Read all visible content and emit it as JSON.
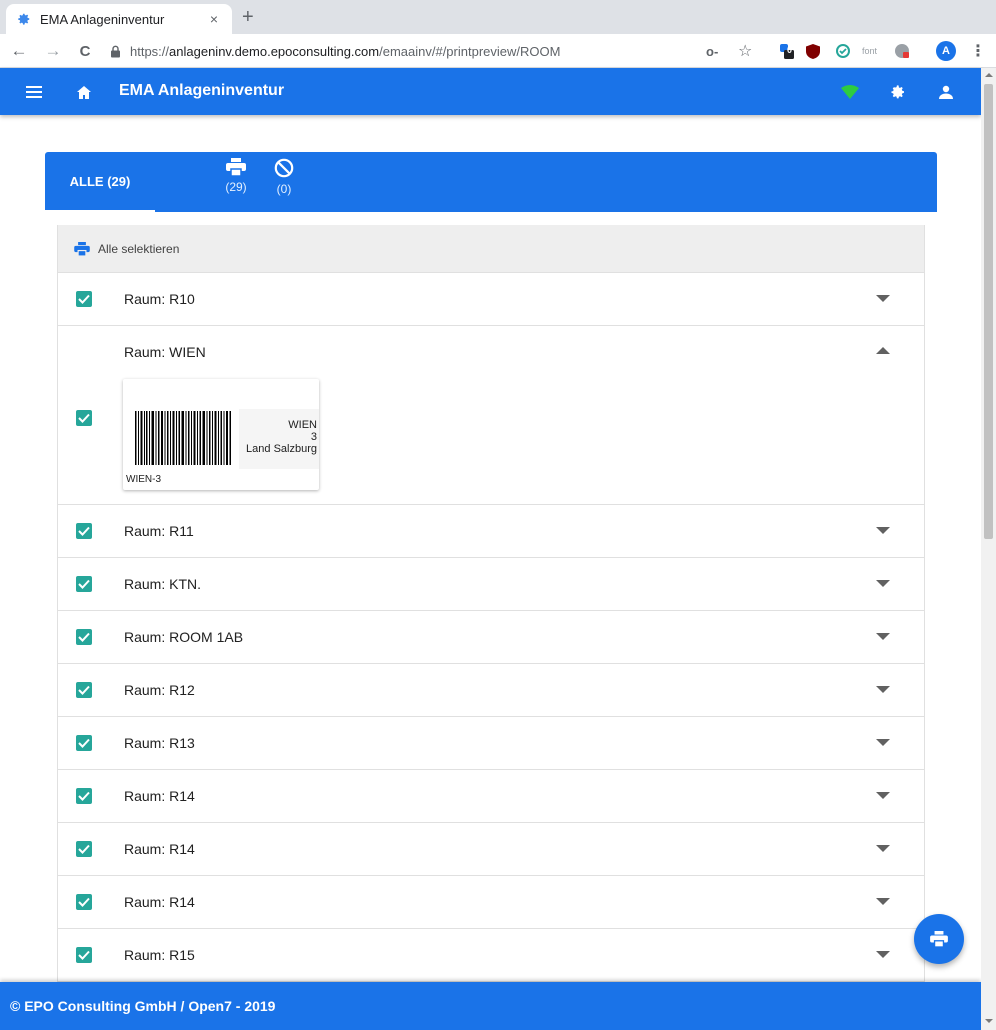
{
  "browser": {
    "tab_title": "EMA Anlageninventur",
    "tab_close": "×",
    "new_tab": "+",
    "back": "←",
    "forward": "→",
    "reload": "C",
    "url_scheme": "https://",
    "url_host": "anlageninv.demo.epoconsulting.com",
    "url_path": "/emaainv/#/printpreview/ROOM",
    "key": "o-",
    "star": "☆",
    "ext_badge": "0",
    "ext_font": "font",
    "profile_initial": "A",
    "menu": "⋮"
  },
  "appbar": {
    "title": "EMA Anlageninventur",
    "colors": {
      "primary": "#1a73e8",
      "wifi": "#2ecc40"
    }
  },
  "tabs": {
    "all": "ALLE (29)",
    "print_count": "(29)",
    "excluded_count": "(0)"
  },
  "list": {
    "select_all": "Alle selektieren",
    "rows": [
      {
        "label": "Raum: R10"
      },
      {
        "label": "Raum: WIEN"
      },
      {
        "label": "Raum: R11"
      },
      {
        "label": "Raum: KTN."
      },
      {
        "label": "Raum: ROOM 1AB"
      },
      {
        "label": "Raum: R12"
      },
      {
        "label": "Raum: R13"
      },
      {
        "label": "Raum: R14"
      },
      {
        "label": "Raum: R14"
      },
      {
        "label": "Raum: R14"
      },
      {
        "label": "Raum: R15"
      }
    ],
    "label_card": {
      "line1": "WIEN",
      "line2": "3",
      "line3": "Land Salzburg",
      "code": "WIEN-3"
    },
    "check_color": "#26a69a"
  },
  "footer": {
    "text": "© EPO Consulting GmbH / Open7 - 2019"
  }
}
